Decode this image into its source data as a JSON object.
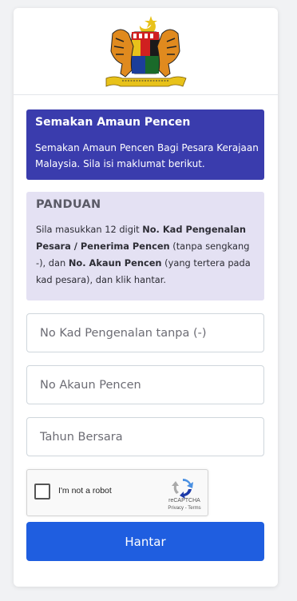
{
  "header": {
    "logo": "malaysia-coat-of-arms",
    "crest_text": "BERSEKUTU BERTAMBAH MUTU"
  },
  "title_box": {
    "title": "Semakan Amaun Pencen",
    "description": "Semakan Amaun Pencen Bagi Pesara Kerajaan Malaysia. Sila isi maklumat berikut."
  },
  "guide": {
    "heading": "PANDUAN",
    "text_1": "Sila masukkan 12 digit ",
    "bold_1": "No. Kad Pengenalan Pesara / Penerima Pencen",
    "text_2": " (tanpa sengkang -), dan ",
    "bold_2": "No. Akaun Pencen",
    "text_3": " (yang tertera pada kad pesara), dan klik hantar."
  },
  "form": {
    "ic_placeholder": "No Kad Pengenalan tanpa (-)",
    "ic_value": "",
    "account_placeholder": "No Akaun Pencen",
    "account_value": "",
    "year_placeholder": "Tahun Bersara",
    "year_value": ""
  },
  "recaptcha": {
    "label": "I'm not a robot",
    "brand": "reCAPTCHA",
    "links": "Privacy - Terms"
  },
  "submit_label": "Hantar",
  "colors": {
    "title_bg": "#3a3cad",
    "guide_bg": "#e4e1f3",
    "button_bg": "#1f5ee0"
  }
}
